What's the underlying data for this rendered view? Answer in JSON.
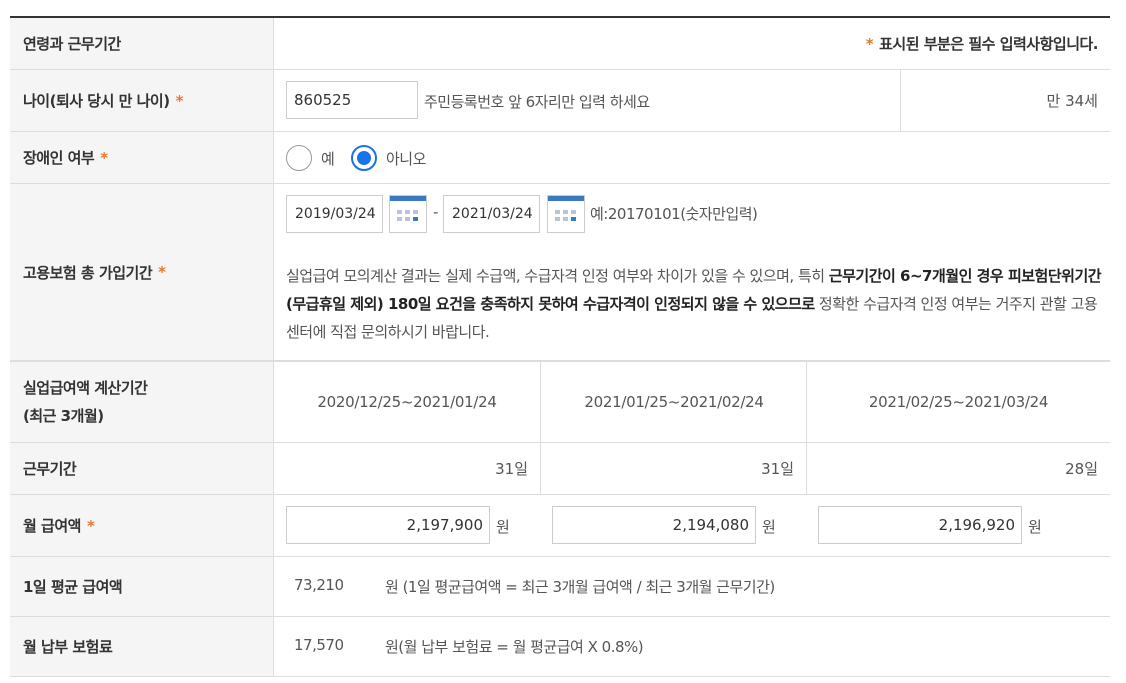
{
  "section_title": "연령과 근무기간",
  "required_note": "표시된 부분은 필수 입력사항입니다.",
  "star": "*",
  "age": {
    "label": "나이(퇴사 당시 만 나이)",
    "value": "860525",
    "hint": "주민등록번호 앞 6자리만 입력 하세요",
    "result": "만 34세"
  },
  "disability": {
    "label": "장애인 여부",
    "options": [
      {
        "label": "예",
        "checked": false
      },
      {
        "label": "아니오",
        "checked": true
      }
    ]
  },
  "insurance": {
    "label": "고용보험 총 가입기간",
    "start": "2019/03/24",
    "separator": "-",
    "end": "2021/03/24",
    "example": "예:20170101(숫자만입력)",
    "notice_a": "실업급여 모의계산 결과는 실제 수급액, 수급자격 인정 여부와 차이가 있을 수 있으며, 특히 ",
    "notice_b": "근무기간이 6~7개월인 경우 피보험단위기간(무급휴일 제외) 180일 요건을 충족하지 못하여 수급자격이 인정되지 않을 수 있으므로",
    "notice_c": " 정확한 수급자격 인정 여부는 거주지 관할 고용센터에 직접 문의하시기 바랍니다."
  },
  "calc_period": {
    "label_line1": "실업급여액 계산기간",
    "label_line2": "(최근 3개월)",
    "periods": [
      "2020/12/25~2021/01/24",
      "2021/01/25~2021/02/24",
      "2021/02/25~2021/03/24"
    ]
  },
  "work_days": {
    "label": "근무기간",
    "values": [
      "31일",
      "31일",
      "28일"
    ]
  },
  "monthly_pay": {
    "label": "월 급여액",
    "values": [
      "2,197,900",
      "2,194,080",
      "2,196,920"
    ],
    "unit": "원"
  },
  "daily_avg": {
    "label": "1일 평균 급여액",
    "value": "73,210",
    "desc": "원 (1일 평균급여액 = 최근 3개월 급여액 / 최근 3개월 근무기간)"
  },
  "premium": {
    "label": "월 납부 보험료",
    "value": "17,570",
    "desc": "원(월 납부 보험료 = 월 평균급여 X 0.8%)"
  },
  "colors": {
    "accent_star": "#e8772e",
    "radio_selected": "#1a73e8",
    "calendar_blue": "#3a78c4"
  }
}
